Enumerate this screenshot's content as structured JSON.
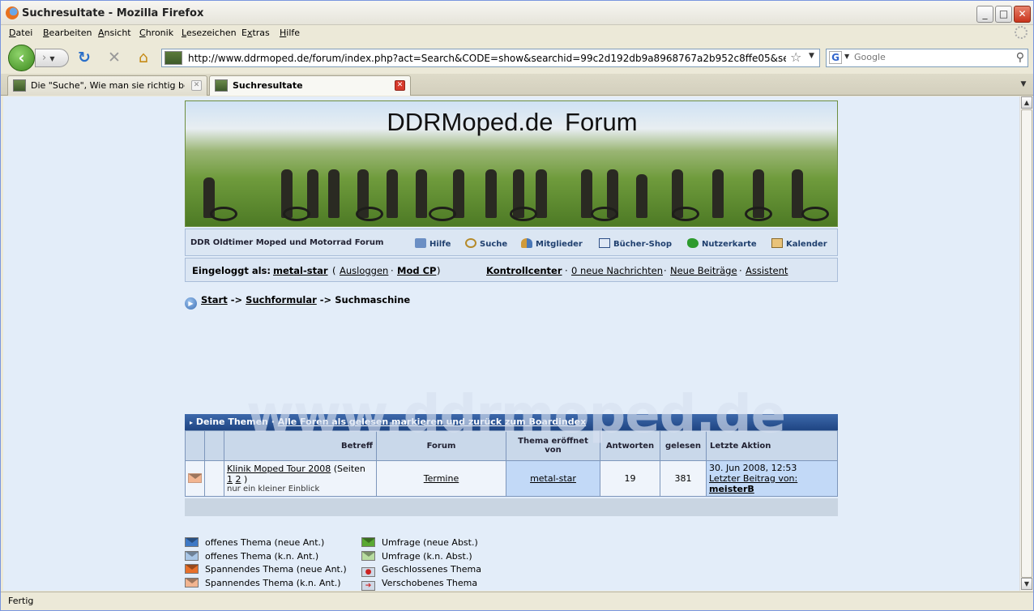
{
  "window": {
    "title": "Suchresultate - Mozilla Firefox"
  },
  "menu": [
    "Datei",
    "Bearbeiten",
    "Ansicht",
    "Chronik",
    "Lesezeichen",
    "Extras",
    "Hilfe"
  ],
  "menu_access_keys": [
    "D",
    "B",
    "A",
    "C",
    "L",
    "x",
    "H"
  ],
  "toolbar": {
    "url": "http://www.ddrmoped.de/forum/index.php?act=Search&CODE=show&searchid=99c2d192db9a8968767a2b952c8ffe05&search_in=titles&result_type=t",
    "search_placeholder": "Google",
    "search_engine_letter": "G"
  },
  "tabs": [
    {
      "label": "Die \"Suche\", Wie man sie richtig benutz...",
      "active": false
    },
    {
      "label": "Suchresultate",
      "active": true
    }
  ],
  "status": "Fertig",
  "forum": {
    "banner_title": "DDRMoped.de  Forum",
    "name": "DDR Oldtimer Moped und Motorrad Forum",
    "nav": [
      {
        "label": "Hilfe",
        "icon": "help-icon"
      },
      {
        "label": "Suche",
        "icon": "search-icon"
      },
      {
        "label": "Mitglieder",
        "icon": "members-icon"
      },
      {
        "label": "Bücher-Shop",
        "icon": "book-icon"
      },
      {
        "label": "Nutzerkarte",
        "icon": "map-icon"
      },
      {
        "label": "Kalender",
        "icon": "calendar-icon"
      }
    ],
    "login": {
      "prefix": "Eingeloggt als:",
      "user": "metal-star",
      "logout": "Ausloggen",
      "modcp": "Mod CP",
      "links": [
        "Kontrollcenter",
        "0 neue Nachrichten",
        "Neue Beiträge",
        "Assistent"
      ]
    },
    "breadcrumb": {
      "start": "Start",
      "form": "Suchformular",
      "current": "Suchmaschine",
      "sep": "->"
    },
    "watermark": "www.ddrmoped.de",
    "results": {
      "header_title": "Deine Themen",
      "header_link": "Alle Foren als gelesen markieren und zurück zum Boardindex",
      "columns": [
        "Betreff",
        "Forum",
        "Thema eröffnet von",
        "Antworten",
        "gelesen",
        "Letzte Aktion"
      ],
      "rows": [
        {
          "topic": "Klinik Moped Tour 2008",
          "pages_prefix": "(Seiten",
          "pages": [
            "1",
            "2"
          ],
          "pages_suffix": ")",
          "description": "nur ein kleiner Einblick",
          "forum": "Termine",
          "starter": "metal-star",
          "replies": "19",
          "views": "381",
          "last_date": "30. Jun 2008, 12:53",
          "last_label": "Letzter Beitrag von:",
          "last_user": "meisterB"
        }
      ]
    },
    "legend": [
      {
        "label": "offenes Thema (neue Ant.)",
        "color": "#3d78c5"
      },
      {
        "label": "offenes Thema (k.n. Ant.)",
        "color": "#a9c6e6"
      },
      {
        "label": "Spannendes Thema (neue Ant.)",
        "color": "#e8702a"
      },
      {
        "label": "Spannendes Thema (k.n. Ant.)",
        "color": "#f2b591"
      },
      {
        "label": "Umfrage (neue Abst.)",
        "color": "#5aa832"
      },
      {
        "label": "Umfrage (k.n. Abst.)",
        "color": "#b8dca0"
      },
      {
        "label": "Geschlossenes Thema",
        "color": "#cfd8e6"
      },
      {
        "label": "Verschobenes Thema",
        "color": "#cfd8e6"
      }
    ]
  }
}
